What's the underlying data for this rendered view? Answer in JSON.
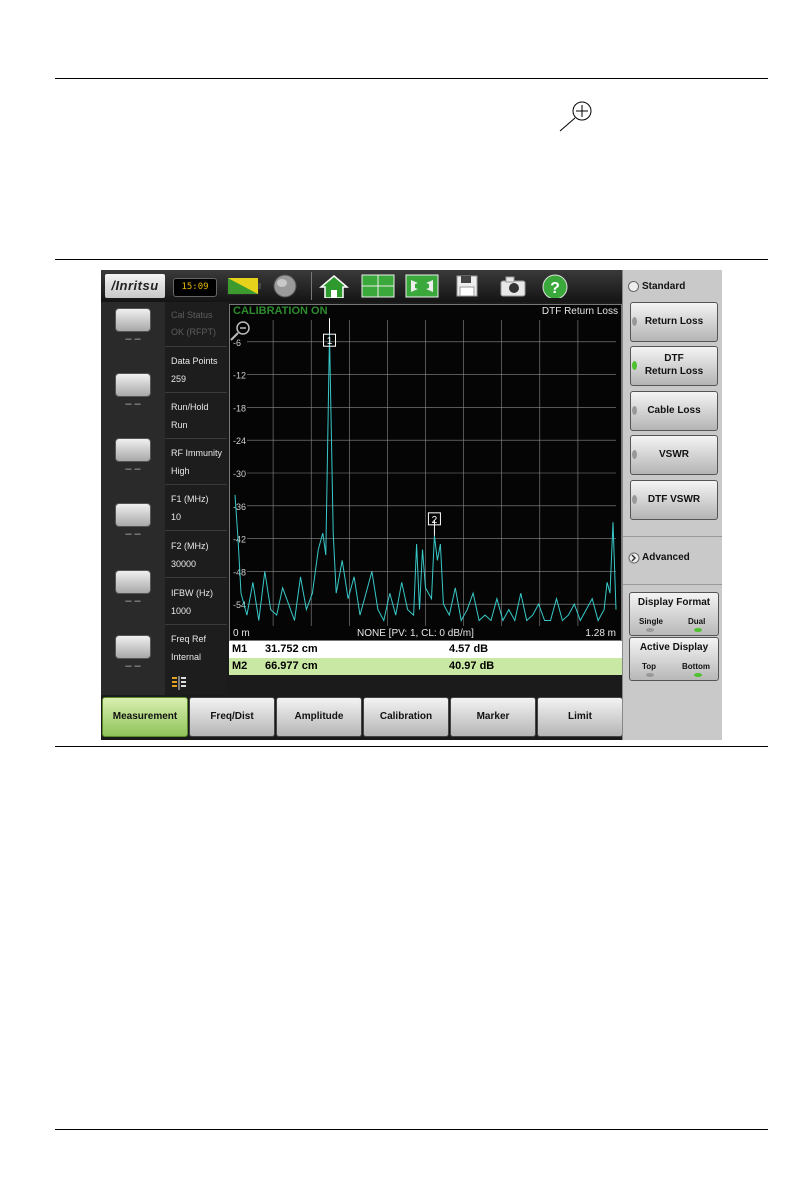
{
  "toolbar": {
    "logo": "/Inritsu",
    "clock": "15:09",
    "icons": [
      "battery-icon",
      "gps-globe-icon",
      "home-icon",
      "layout-icon",
      "zoom-display-icon",
      "save-icon",
      "camera-icon",
      "help-icon"
    ]
  },
  "left_softkeys": [
    {
      "label": "– –"
    },
    {
      "label": "– –"
    },
    {
      "label": "– –"
    },
    {
      "label": "– –"
    },
    {
      "label": "– –"
    },
    {
      "label": "– –"
    }
  ],
  "params": [
    {
      "label": "Cal Status",
      "value": "OK (RFPT)"
    },
    {
      "label": "Data Points",
      "value": "259"
    },
    {
      "label": "Run/Hold",
      "value": "Run"
    },
    {
      "label": "RF Immunity",
      "value": "High"
    },
    {
      "label": "F1 (MHz)",
      "value": "10"
    },
    {
      "label": "F2 (MHz)",
      "value": "30000"
    },
    {
      "label": "IFBW (Hz)",
      "value": "1000"
    },
    {
      "label": "Freq Ref",
      "value": "Internal"
    }
  ],
  "graph": {
    "status": "CALIBRATION ON",
    "measurement": "DTF Return Loss",
    "y_ticks": [
      "-6",
      "-12",
      "-18",
      "-24",
      "-30",
      "-36",
      "-42",
      "-48",
      "-54"
    ],
    "x_start": "0 m",
    "x_end": "1.28 m",
    "footer": "NONE [PV: 1,  CL: 0 dB/m]",
    "marker_labels": [
      "1",
      "2"
    ],
    "colors": {
      "trace": "#39c8c8",
      "grid": "#8a8a8a",
      "status": "#2e8b2e"
    }
  },
  "chart_data": {
    "type": "line",
    "title": "DTF Return Loss",
    "xlim": [
      0,
      1.28
    ],
    "ylim": [
      -58,
      -2
    ],
    "y_ticks": [
      -6,
      -12,
      -18,
      -24,
      -30,
      -36,
      -42,
      -48,
      -54
    ],
    "grid": true,
    "series": [
      {
        "x": [
          0.0,
          0.01,
          0.02,
          0.04,
          0.06,
          0.08,
          0.1,
          0.12,
          0.14,
          0.16,
          0.18,
          0.2,
          0.22,
          0.24,
          0.26,
          0.28,
          0.295,
          0.305,
          0.3175,
          0.33,
          0.34,
          0.36,
          0.38,
          0.4,
          0.42,
          0.44,
          0.46,
          0.48,
          0.5,
          0.52,
          0.54,
          0.56,
          0.58,
          0.6,
          0.61,
          0.62,
          0.63,
          0.64,
          0.66,
          0.67,
          0.68,
          0.69,
          0.7,
          0.72,
          0.74,
          0.76,
          0.78,
          0.8,
          0.82,
          0.84,
          0.86,
          0.88,
          0.9,
          0.92,
          0.94,
          0.96,
          0.98,
          1.0,
          1.02,
          1.04,
          1.06,
          1.08,
          1.1,
          1.12,
          1.14,
          1.16,
          1.18,
          1.2,
          1.22,
          1.24,
          1.25,
          1.26,
          1.27,
          1.28
        ],
        "y": [
          -34,
          -42,
          -52,
          -56,
          -50,
          -57,
          -48,
          -55,
          -56,
          -51,
          -54,
          -57,
          -49,
          -55,
          -52,
          -44,
          -41,
          -45,
          -4.6,
          -41,
          -52,
          -46,
          -53,
          -49,
          -56,
          -52,
          -48,
          -55,
          -57,
          -52,
          -56,
          -50,
          -55,
          -56,
          -43,
          -55,
          -44,
          -51,
          -53,
          -41.5,
          -46,
          -43,
          -54,
          -56,
          -51,
          -57,
          -55,
          -52,
          -57,
          -56,
          -57,
          -53,
          -57,
          -55,
          -57,
          -52,
          -57,
          -56,
          -54,
          -57,
          -57,
          -53,
          -57,
          -56,
          -54,
          -57,
          -55,
          -53,
          -57,
          -55,
          -50,
          -52,
          -39,
          -55
        ]
      }
    ],
    "markers": [
      {
        "name": "M1",
        "distance": "31.752 cm",
        "value": "4.57 dB"
      },
      {
        "name": "M2",
        "distance": "66.977 cm",
        "value": "40.97 dB"
      }
    ]
  },
  "bottom_menu": [
    {
      "label": "Measurement",
      "active": true
    },
    {
      "label": "Freq/Dist",
      "active": false
    },
    {
      "label": "Amplitude",
      "active": false
    },
    {
      "label": "Calibration",
      "active": false
    },
    {
      "label": "Marker",
      "active": false
    },
    {
      "label": "Limit",
      "active": false
    }
  ],
  "right_menu": {
    "standard": "Standard",
    "buttons": [
      {
        "line1": "Return Loss",
        "line2": "",
        "selected": false
      },
      {
        "line1": "DTF",
        "line2": "Return Loss",
        "selected": true
      },
      {
        "line1": "Cable Loss",
        "line2": "",
        "selected": false
      },
      {
        "line1": "VSWR",
        "line2": "",
        "selected": false
      },
      {
        "line1": "DTF VSWR",
        "line2": "",
        "selected": false
      }
    ],
    "advanced": "Advanced",
    "display_format": {
      "title": "Display Format",
      "opt1": "Single",
      "opt2": "Dual",
      "selected": "Dual"
    },
    "active_display": {
      "title": "Active Display",
      "opt1": "Top",
      "opt2": "Bottom",
      "selected": "Bottom"
    }
  }
}
